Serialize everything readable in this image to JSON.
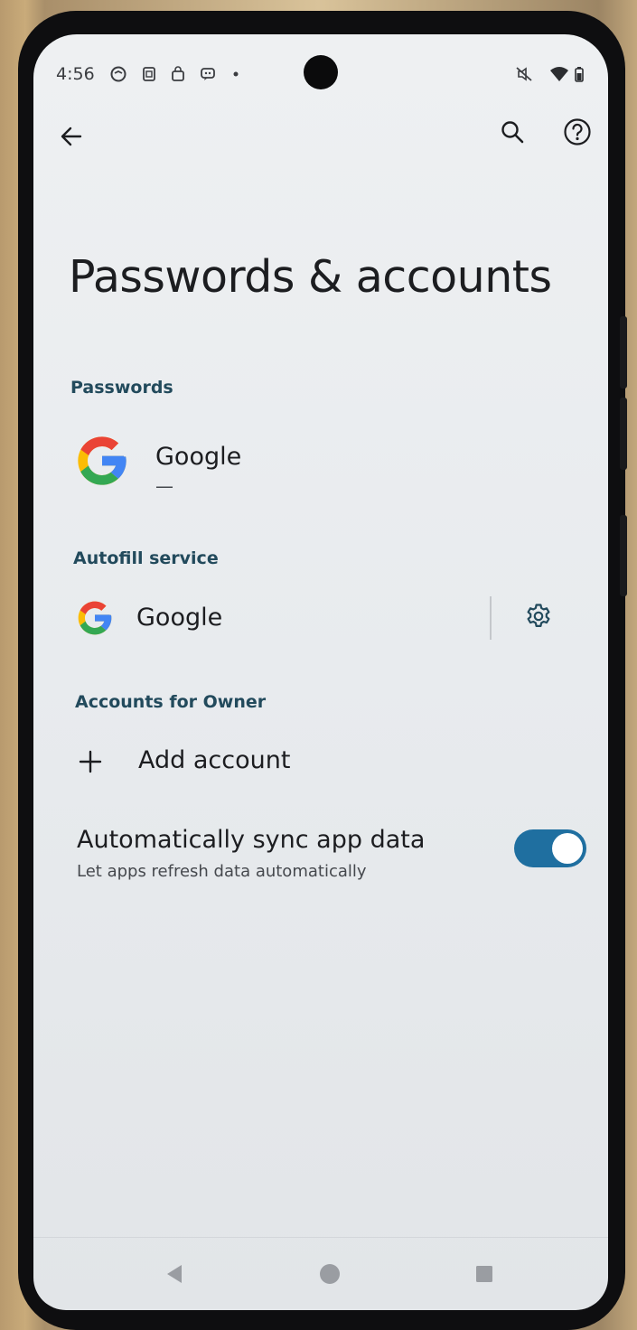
{
  "status_bar": {
    "time": "4:56",
    "left_icons": [
      "messenger-icon",
      "sim-icon",
      "bag-icon",
      "chat-icon",
      "dot-icon"
    ],
    "right_icons": [
      "mute-icon",
      "wifi-icon",
      "battery-icon"
    ]
  },
  "toolbar": {
    "back_icon": "arrow-left-icon",
    "search_icon": "search-icon",
    "help_icon": "help-circle-icon"
  },
  "page": {
    "title": "Passwords & accounts"
  },
  "passwords": {
    "header": "Passwords",
    "item": {
      "title": "Google",
      "subtitle": "—"
    }
  },
  "autofill": {
    "header": "Autofill service",
    "item": {
      "title": "Google"
    },
    "settings_icon": "gear-icon"
  },
  "accounts": {
    "header": "Accounts for Owner",
    "add_label": "Add account"
  },
  "sync": {
    "title": "Automatically sync app data",
    "subtitle": "Let apps refresh data automatically",
    "enabled": true
  },
  "nav": {
    "back": "back-triangle-icon",
    "home": "home-circle-icon",
    "recents": "recents-square-icon"
  },
  "colors": {
    "accent": "#224a5c",
    "toggle_on": "#1f6fa0",
    "google_blue": "#4285F4",
    "google_red": "#EA4335",
    "google_yellow": "#FBBC05",
    "google_green": "#34A853"
  }
}
